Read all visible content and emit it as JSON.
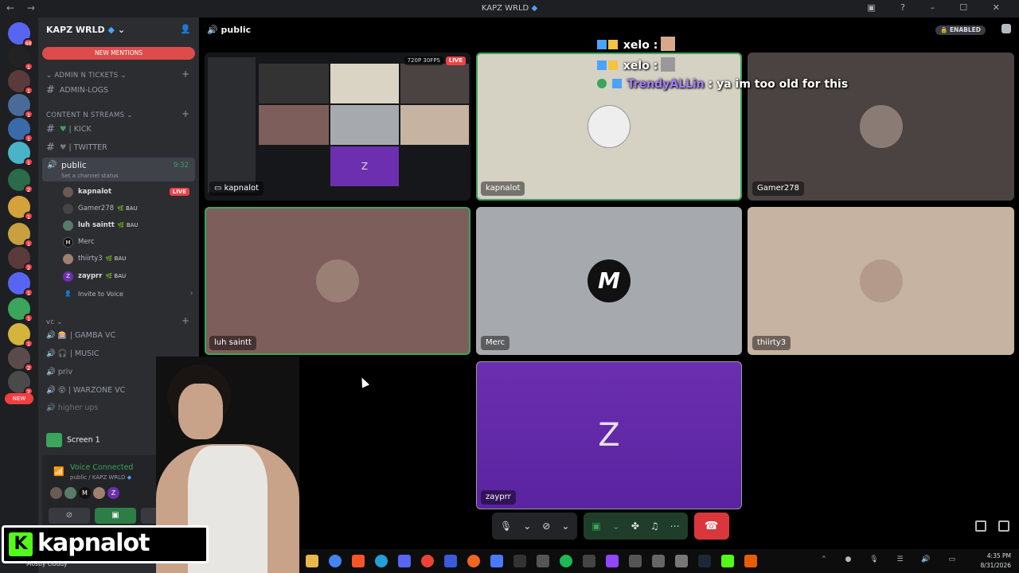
{
  "window": {
    "title": "KAPZ WRLD",
    "nav": "← →",
    "controls": "▣ ? – ☐ ✕"
  },
  "servers": [
    {
      "badge": "48"
    },
    {
      "badge": "1"
    },
    {
      "badge": "1"
    },
    {
      "badge": "1"
    },
    {
      "badge": "1"
    },
    {
      "badge": "1"
    },
    {
      "badge": "2"
    },
    {
      "badge": "1"
    },
    {
      "badge": "1"
    },
    {
      "badge": "2"
    },
    {
      "badge": "1"
    },
    {
      "badge": "1"
    },
    {
      "badge": "1"
    },
    {
      "badge": "2"
    },
    {
      "badge": "2"
    }
  ],
  "server_new": "NEW",
  "sidebar": {
    "server_name": "KAPZ WRLD",
    "new_mentions": "NEW MENTIONS",
    "categories": {
      "admin": "ADMIN N TICKETS",
      "content": "CONTENT N STREAMS",
      "vc": "vc"
    },
    "channels": {
      "admin_logs": "ADMIN-LOGS",
      "kick": "| KICK",
      "twitter": "| TWITTER",
      "gamba": "| GAMBA VC",
      "music": "| MUSIC",
      "priv": "priv",
      "warzone": "| WARZONE VC",
      "higher_ups": "higher ups"
    },
    "active_channel": {
      "name": "public",
      "status": "Set a channel status",
      "time": "9:32"
    },
    "members": [
      {
        "name": "kapnalot",
        "badge": "",
        "live": "LIVE"
      },
      {
        "name": "Gamer278",
        "badge": "BAU",
        "live": ""
      },
      {
        "name": "luh saintt",
        "badge": "BAU",
        "live": ""
      },
      {
        "name": "Merc",
        "badge": "",
        "live": ""
      },
      {
        "name": "thiirty3",
        "badge": "BAU",
        "live": ""
      },
      {
        "name": "zayprr",
        "badge": "BAU",
        "live": ""
      }
    ],
    "invite": "Invite to Voice",
    "screen_panel": "Screen 1",
    "voice": {
      "status": "Voice Connected",
      "sub": "public / KAPZ WRLD",
      "user_partial": "...lot"
    }
  },
  "main": {
    "channel": "public",
    "enabled": "ENABLED",
    "tiles": {
      "stream": {
        "label": "kapnalot",
        "res": "720P 30FPS",
        "live": "LIVE"
      },
      "t1": "kapnalot",
      "t2": "Gamer278",
      "t3": "luh saintt",
      "t4": "Merc",
      "t5": "thiirty3",
      "t6": "zayprr",
      "z_letter": "Z"
    }
  },
  "chat": [
    {
      "user": "xelo",
      "sep": " :",
      "text": ""
    },
    {
      "user": "xelo",
      "sep": " :",
      "text": ""
    },
    {
      "user": "TrendyALLin",
      "sep": " :",
      "text": " ya im too old for this"
    }
  ],
  "overlay": {
    "brand": "kapnalot",
    "brand_letter": "K",
    "weather": "Mostly cloudy"
  },
  "taskbar": {
    "time": "4:35 PM",
    "date": "8/31/2026"
  },
  "colors": {
    "accent_green": "#3ba55c",
    "mention_red": "#dd4b4b",
    "z_purple": "#6b2fb0",
    "kick_green": "#53fc18"
  }
}
